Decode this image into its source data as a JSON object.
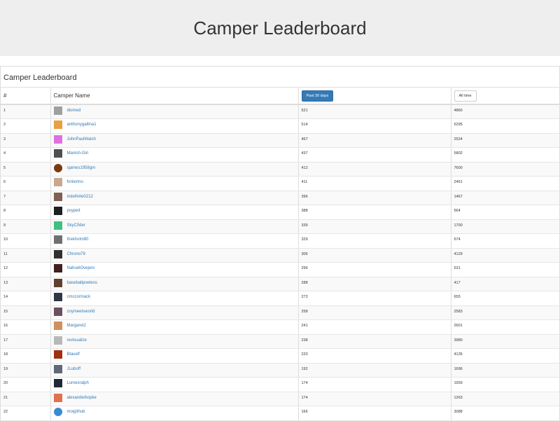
{
  "header": {
    "title": "Camper Leaderboard"
  },
  "panel": {
    "title": "Camper Leaderboard"
  },
  "table": {
    "col_rank": "#",
    "col_name": "Camper Name",
    "btn_recent": "Past 30 days",
    "btn_alltime": "All time",
    "rows": [
      {
        "rank": "1",
        "name": "diomed",
        "recent": "521",
        "alltime": "4860",
        "avatar_color": "#a0a0a0"
      },
      {
        "rank": "2",
        "name": "anthonygallina1",
        "recent": "514",
        "alltime": "5295",
        "avatar_color": "#e8a040"
      },
      {
        "rank": "3",
        "name": "JohnPaulWalsh",
        "recent": "467",
        "alltime": "2524",
        "avatar_color": "#e070e0"
      },
      {
        "rank": "4",
        "name": "Manish-Giri",
        "recent": "437",
        "alltime": "5802",
        "avatar_color": "#505050"
      },
      {
        "rank": "5",
        "name": "sjames1958gm",
        "recent": "412",
        "alltime": "7600",
        "avatar_color": "#7a3a10",
        "round": true
      },
      {
        "rank": "6",
        "name": "forkerino",
        "recent": "411",
        "alltime": "2461",
        "avatar_color": "#c8a890"
      },
      {
        "rank": "7",
        "name": "indefinite0212",
        "recent": "396",
        "alltime": "1467",
        "avatar_color": "#806050"
      },
      {
        "rank": "8",
        "name": "psypeit",
        "recent": "388",
        "alltime": "564",
        "avatar_color": "#202020"
      },
      {
        "rank": "9",
        "name": "SkyC0der",
        "recent": "339",
        "alltime": "1700",
        "avatar_color": "#40c080"
      },
      {
        "rank": "10",
        "name": "thekholm80",
        "recent": "329",
        "alltime": "674",
        "avatar_color": "#707070"
      },
      {
        "rank": "11",
        "name": "Chrono79",
        "recent": "306",
        "alltime": "4129",
        "avatar_color": "#303030"
      },
      {
        "rank": "12",
        "name": "NahuelOvejero",
        "recent": "296",
        "alltime": "531",
        "avatar_color": "#402020"
      },
      {
        "rank": "13",
        "name": "baseballpoetess",
        "recent": "288",
        "alltime": "417",
        "avatar_color": "#604030"
      },
      {
        "rank": "14",
        "name": "cmccormack",
        "recent": "273",
        "alltime": "655",
        "avatar_color": "#303848"
      },
      {
        "rank": "15",
        "name": "zoymeetsworld",
        "recent": "258",
        "alltime": "2583",
        "avatar_color": "#6a5060"
      },
      {
        "rank": "16",
        "name": "Margaret2",
        "recent": "241",
        "alltime": "2601",
        "avatar_color": "#d09060"
      },
      {
        "rank": "17",
        "name": "revisualize",
        "recent": "238",
        "alltime": "3980",
        "avatar_color": "#b8b8b8"
      },
      {
        "rank": "18",
        "name": "Blauelf",
        "recent": "220",
        "alltime": "4135",
        "avatar_color": "#a03010"
      },
      {
        "rank": "19",
        "name": "JLuboff",
        "recent": "192",
        "alltime": "1696",
        "avatar_color": "#606878"
      },
      {
        "rank": "20",
        "name": "Lumexralph",
        "recent": "174",
        "alltime": "1659",
        "avatar_color": "#202838"
      },
      {
        "rank": "21",
        "name": "alexanderkopke",
        "recent": "174",
        "alltime": "1263",
        "avatar_color": "#e07050"
      },
      {
        "rank": "22",
        "name": "moigithub",
        "recent": "166",
        "alltime": "3088",
        "avatar_color": "#3a8ad0",
        "round": true
      }
    ]
  },
  "colors": {
    "accent": "#337ab7",
    "header_bg": "#eeeeee",
    "stripe": "#f9f9f9"
  }
}
